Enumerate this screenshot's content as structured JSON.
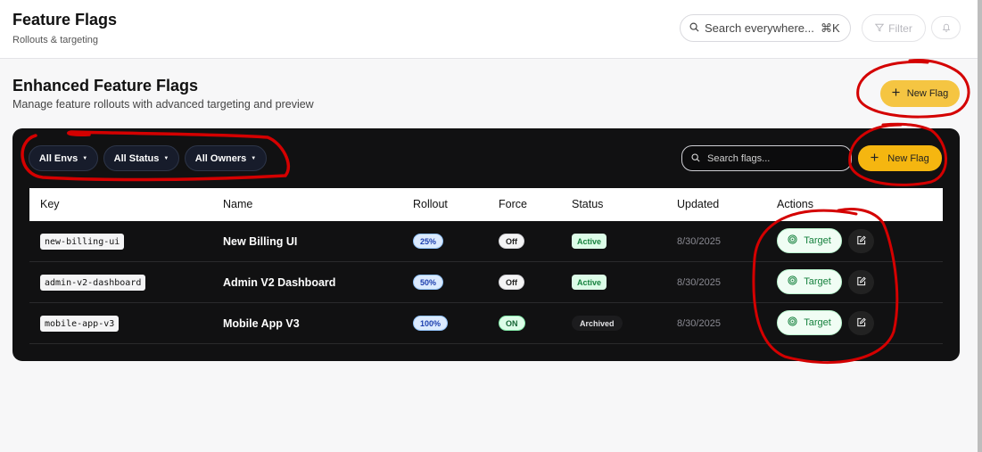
{
  "header": {
    "title": "Feature Flags",
    "subtitle": "Rollouts & targeting",
    "search_placeholder": "Search everywhere...",
    "search_shortcut": "⌘K",
    "filter_label": "Filter"
  },
  "page": {
    "title": "Enhanced Feature Flags",
    "subtitle": "Manage feature rollouts with advanced targeting and preview",
    "new_flag_label": "New Flag"
  },
  "toolbar": {
    "filters": [
      {
        "label": "All Envs"
      },
      {
        "label": "All Status"
      },
      {
        "label": "All Owners"
      }
    ],
    "search_placeholder": "Search flags...",
    "new_flag_label": "New Flag"
  },
  "table": {
    "columns": [
      "Key",
      "Name",
      "Rollout",
      "Force",
      "Status",
      "Updated",
      "Actions"
    ],
    "rows": [
      {
        "key": "new-billing-ui",
        "name": "New Billing UI",
        "rollout": "25%",
        "force": "Off",
        "status": "Active",
        "updated": "8/30/2025",
        "target_label": "Target"
      },
      {
        "key": "admin-v2-dashboard",
        "name": "Admin V2 Dashboard",
        "rollout": "50%",
        "force": "Off",
        "status": "Active",
        "updated": "8/30/2025",
        "target_label": "Target"
      },
      {
        "key": "mobile-app-v3",
        "name": "Mobile App V3",
        "rollout": "100%",
        "force": "ON",
        "status": "Archived",
        "updated": "8/30/2025",
        "target_label": "Target"
      }
    ]
  },
  "colors": {
    "accent_yellow": "#f5c542",
    "panel_bg": "#111112",
    "annotation_red": "#d40000",
    "active_green": "#15803d"
  },
  "icons": [
    "search-icon",
    "filter-icon",
    "bell-icon",
    "plus-icon",
    "caret-down-icon",
    "target-icon",
    "edit-icon"
  ]
}
